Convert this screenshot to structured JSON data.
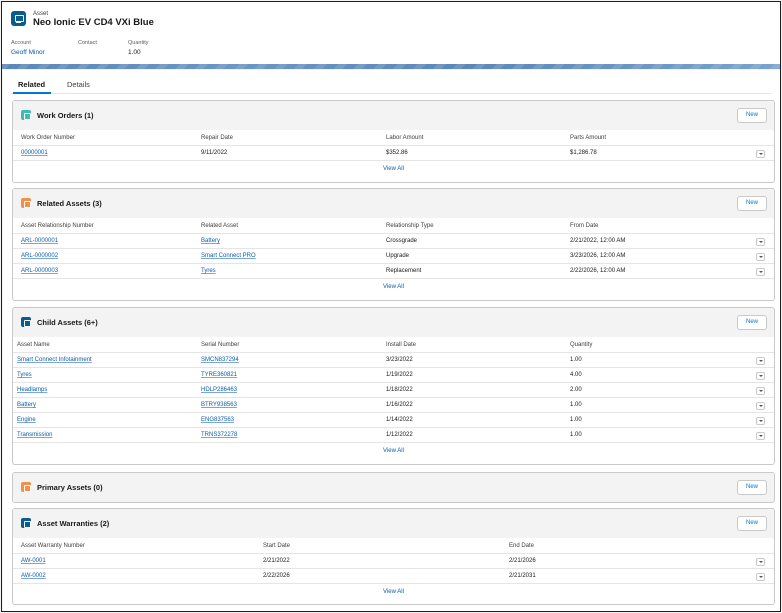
{
  "record": {
    "object_label": "Asset",
    "title": "Neo Ionic EV CD4 VXi Blue",
    "fields": [
      {
        "label": "Account",
        "value": "Geoff Minor",
        "link": true
      },
      {
        "label": "Contact",
        "value": "",
        "link": false
      },
      {
        "label": "Quantity",
        "value": "1.00",
        "link": false
      }
    ]
  },
  "tabs": [
    {
      "label": "Related",
      "active": true
    },
    {
      "label": "Details",
      "active": false
    }
  ],
  "colors": {
    "work_orders_icon": "#3bbeb0",
    "related_assets_icon": "#f48e49",
    "child_assets_icon": "#0b5c8e",
    "primary_assets_icon": "#f48e49",
    "warranties_icon": "#0b5c8e",
    "link": "#0b5cab"
  },
  "new_label": "New",
  "view_all_label": "View All",
  "work_orders": {
    "title": "Work Orders (1)",
    "icon": "work-order-icon",
    "columns": [
      "Work Order Number",
      "Repair Date",
      "Labor Amount",
      "Parts Amount"
    ],
    "rows": [
      [
        "00000001",
        "9/11/2022",
        "$352.86",
        "$1,286.78"
      ]
    ]
  },
  "related_assets": {
    "title": "Related Assets (3)",
    "icon": "related-asset-icon",
    "columns": [
      "Asset Relationship Number",
      "Related Asset",
      "Relationship Type",
      "From Date"
    ],
    "rows": [
      [
        "ARL-0000001",
        "Battery",
        "Crossgrade",
        "2/21/2022, 12:00 AM"
      ],
      [
        "ARL-0000002",
        "Smart Connect PRO",
        "Upgrade",
        "3/23/2026, 12:00 AM"
      ],
      [
        "ARL-0000003",
        "Tyres",
        "Replacement",
        "2/22/2026, 12:00 AM"
      ]
    ]
  },
  "child_assets": {
    "title": "Child Assets (6+)",
    "icon": "asset-icon",
    "columns": [
      "Asset Name",
      "Serial Number",
      "Install Date",
      "Quantity"
    ],
    "rows": [
      [
        "Smart Connect Infotainment",
        "SMCN837294",
        "3/23/2022",
        "1.00"
      ],
      [
        "Tyres",
        "TYRE360821",
        "1/19/2022",
        "4.00"
      ],
      [
        "Headlamps",
        "HDLP286463",
        "1/18/2022",
        "2.00"
      ],
      [
        "Battery",
        "BTRY938563",
        "1/16/2022",
        "1.00"
      ],
      [
        "Engine",
        "ENG837563",
        "1/14/2022",
        "1.00"
      ],
      [
        "Transmission",
        "TRNS372278",
        "1/12/2022",
        "1.00"
      ]
    ]
  },
  "primary_assets": {
    "title": "Primary Assets (0)",
    "icon": "related-asset-icon"
  },
  "asset_warranties": {
    "title": "Asset Warranties (2)",
    "icon": "warranty-icon",
    "columns": [
      "Asset Warranty Number",
      "Start Date",
      "End Date"
    ],
    "rows": [
      [
        "AW-0001",
        "2/21/2022",
        "2/21/2026"
      ],
      [
        "AW-0002",
        "2/22/2026",
        "2/21/2031"
      ]
    ]
  }
}
